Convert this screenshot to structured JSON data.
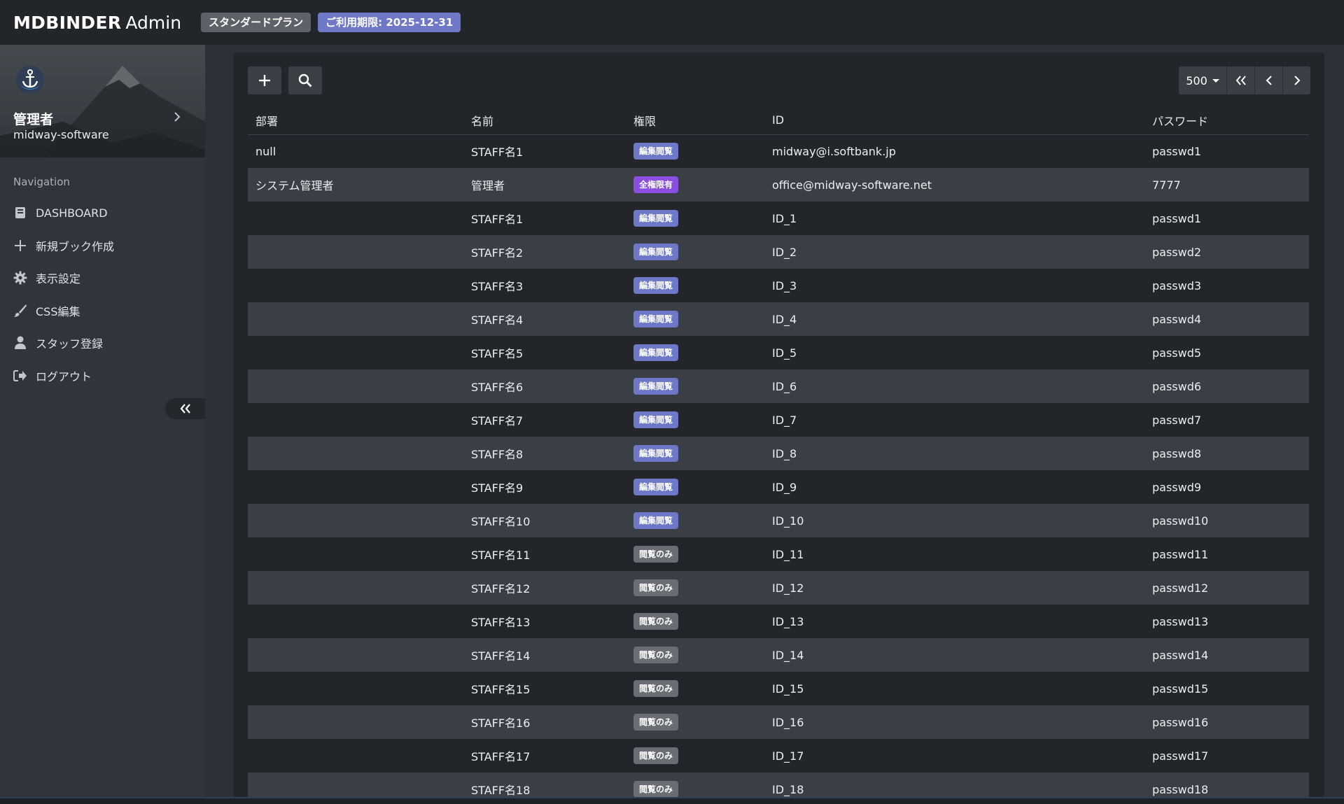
{
  "header": {
    "brand_bold": "MDBINDER",
    "brand_light": "Admin",
    "plan_label": "スタンダードプラン",
    "expiry_label": "ご利用期限: 2025-12-31",
    "colors": {
      "plan": "#5e6268",
      "expiry": "#6f78c6",
      "bar": "#22262b"
    }
  },
  "sidebar": {
    "profile": {
      "name": "管理者",
      "org": "midway-software"
    },
    "nav_label": "Navigation",
    "items": [
      {
        "label": "DASHBOARD",
        "icon": "book-icon"
      },
      {
        "label": "新規ブック作成",
        "icon": "plus-icon"
      },
      {
        "label": "表示設定",
        "icon": "gear-icon"
      },
      {
        "label": "CSS編集",
        "icon": "brush-icon"
      },
      {
        "label": "スタッフ登録",
        "icon": "user-icon"
      },
      {
        "label": "ログアウト",
        "icon": "logout-icon"
      }
    ]
  },
  "toolbar": {
    "add_icon": "plus-icon",
    "search_icon": "search-icon",
    "page_size": "500",
    "first_icon": "double-chevron-left-icon",
    "prev_icon": "chevron-left-icon",
    "next_icon": "chevron-right-icon"
  },
  "table": {
    "columns": [
      "部署",
      "名前",
      "権限",
      "ID",
      "パスワード"
    ],
    "badge_colors": {
      "編集閲覧": "#6f78c6",
      "全権限有": "#8a4fe0",
      "閲覧のみ": "#6a6e74"
    },
    "rows": [
      [
        "null",
        "STAFF名1",
        "編集閲覧",
        "midway@i.softbank.jp",
        "passwd1"
      ],
      [
        "システム管理者",
        "管理者",
        "全権限有",
        "office@midway-software.net",
        "7777"
      ],
      [
        "",
        "STAFF名1",
        "編集閲覧",
        "ID_1",
        "passwd1"
      ],
      [
        "",
        "STAFF名2",
        "編集閲覧",
        "ID_2",
        "passwd2"
      ],
      [
        "",
        "STAFF名3",
        "編集閲覧",
        "ID_3",
        "passwd3"
      ],
      [
        "",
        "STAFF名4",
        "編集閲覧",
        "ID_4",
        "passwd4"
      ],
      [
        "",
        "STAFF名5",
        "編集閲覧",
        "ID_5",
        "passwd5"
      ],
      [
        "",
        "STAFF名6",
        "編集閲覧",
        "ID_6",
        "passwd6"
      ],
      [
        "",
        "STAFF名7",
        "編集閲覧",
        "ID_7",
        "passwd7"
      ],
      [
        "",
        "STAFF名8",
        "編集閲覧",
        "ID_8",
        "passwd8"
      ],
      [
        "",
        "STAFF名9",
        "編集閲覧",
        "ID_9",
        "passwd9"
      ],
      [
        "",
        "STAFF名10",
        "編集閲覧",
        "ID_10",
        "passwd10"
      ],
      [
        "",
        "STAFF名11",
        "閲覧のみ",
        "ID_11",
        "passwd11"
      ],
      [
        "",
        "STAFF名12",
        "閲覧のみ",
        "ID_12",
        "passwd12"
      ],
      [
        "",
        "STAFF名13",
        "閲覧のみ",
        "ID_13",
        "passwd13"
      ],
      [
        "",
        "STAFF名14",
        "閲覧のみ",
        "ID_14",
        "passwd14"
      ],
      [
        "",
        "STAFF名15",
        "閲覧のみ",
        "ID_15",
        "passwd15"
      ],
      [
        "",
        "STAFF名16",
        "閲覧のみ",
        "ID_16",
        "passwd16"
      ],
      [
        "",
        "STAFF名17",
        "閲覧のみ",
        "ID_17",
        "passwd17"
      ],
      [
        "",
        "STAFF名18",
        "閲覧のみ",
        "ID_18",
        "passwd18"
      ]
    ]
  }
}
